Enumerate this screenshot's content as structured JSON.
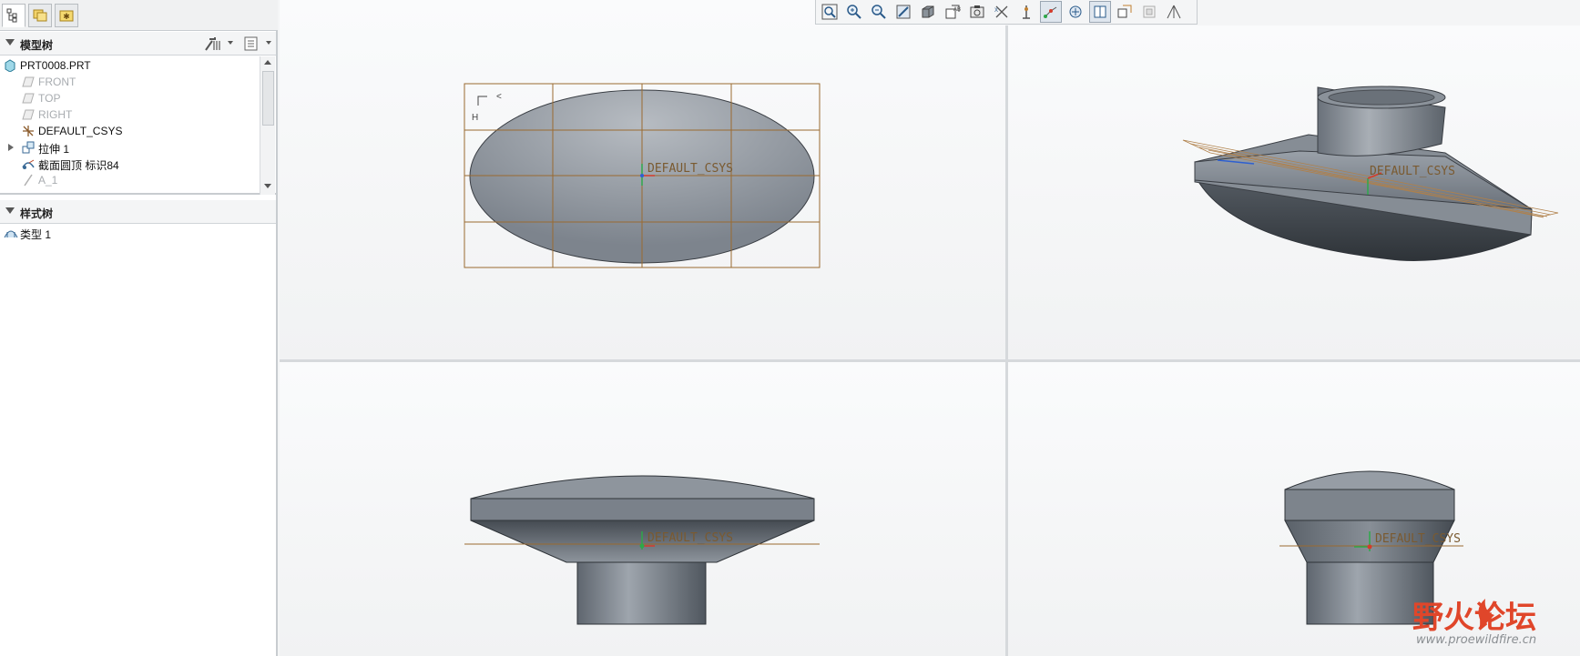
{
  "left_panel": {
    "model_tree_header": "模型树",
    "style_tree_header": "样式树",
    "tree_items": [
      {
        "label": "PRT0008.PRT",
        "icon": "part-icon",
        "dim": false
      },
      {
        "label": "FRONT",
        "icon": "datum-plane-icon",
        "dim": true
      },
      {
        "label": "TOP",
        "icon": "datum-plane-icon",
        "dim": true
      },
      {
        "label": "RIGHT",
        "icon": "datum-plane-icon",
        "dim": true
      },
      {
        "label": "DEFAULT_CSYS",
        "icon": "csys-icon",
        "dim": false
      },
      {
        "label": "拉伸 1",
        "icon": "extrude-icon",
        "dim": false
      },
      {
        "label": "截面圆顶 标识84",
        "icon": "section-dome-icon",
        "dim": false
      },
      {
        "label": "A_1",
        "icon": "axis-icon",
        "dim": true
      }
    ],
    "style_items": [
      {
        "label": "类型 1",
        "icon": "style-icon"
      }
    ]
  },
  "viewports": {
    "csys_label": "DEFAULT_CSYS"
  },
  "watermark": {
    "text": "野火论坛",
    "url": "www.proewildfire.cn"
  },
  "colors": {
    "panel_bg": "#ffffff",
    "viewport_bg": "#f4f5f6",
    "datum_color": "#9a6a30",
    "model_color": "#7e8690",
    "watermark_red": "#e0462a"
  }
}
